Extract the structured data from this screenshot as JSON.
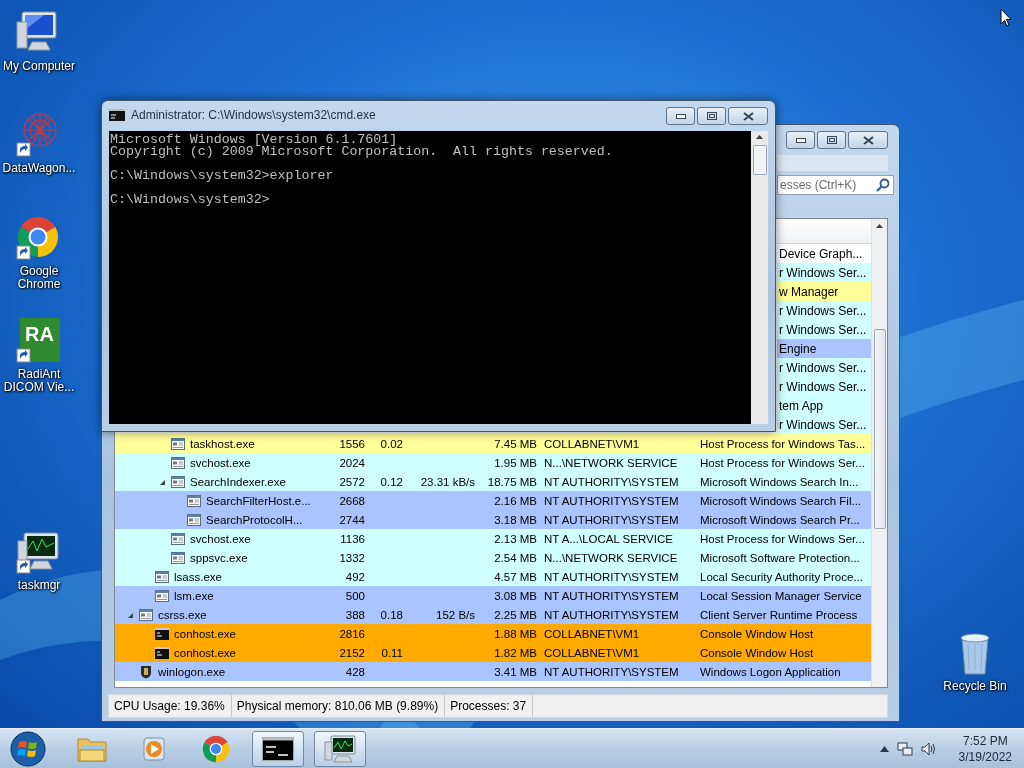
{
  "desktop_icons": [
    {
      "label": "My Computer",
      "kind": "computer",
      "shortcut": false
    },
    {
      "label": "DataWagon...",
      "kind": "network",
      "shortcut": true
    },
    {
      "label": "Google Chrome",
      "kind": "chrome",
      "shortcut": true
    },
    {
      "label": "RadiAnt DICOM Vie...",
      "kind": "logo",
      "logo_text": "RA",
      "shortcut": true
    },
    {
      "label": "taskmgr",
      "kind": "monitor",
      "shortcut": true
    },
    {
      "label": "Recycle Bin",
      "kind": "bin",
      "shortcut": false
    }
  ],
  "process_window": {
    "search": {
      "placeholder": "esses (Ctrl+K)"
    },
    "processes": [
      {
        "children": [
          {
            "children": [
              {
                "description": "Device Graph...",
                "color": "#ffffff"
              },
              {
                "description": "r Windows Ser...",
                "color": "#d0ffff"
              },
              {
                "description": "w Manager",
                "color": "#ffff99"
              },
              {
                "description": "r Windows Ser...",
                "color": "#d0ffff"
              },
              {
                "description": "r Windows Ser...",
                "color": "#d0ffff"
              },
              {
                "description": "Engine",
                "color": "#aac4ff"
              },
              {
                "description": "r Windows Ser...",
                "color": "#d0ffff"
              },
              {
                "description": "r Windows Ser...",
                "color": "#d0ffff"
              },
              {
                "description": "tem App",
                "color": "#d0ffff"
              },
              {
                "description": "r Windows Ser...",
                "color": "#d0ffff"
              },
              {
                "kind": "process",
                "name": "taskhost.exe",
                "pid": "1556",
                "cpu": "0.02",
                "private": "7.45 MB",
                "user": "COLLABNET\\VM1",
                "description": "Host Process for Windows Tas...",
                "color": "#ffff99"
              },
              {
                "kind": "process",
                "name": "svchost.exe",
                "pid": "2024",
                "private": "1.95 MB",
                "user": "N...\\NETWORK SERVICE",
                "description": "Host Process for Windows Ser...",
                "color": "#d0ffff"
              },
              {
                "kind": "process",
                "name": "SearchIndexer.exe",
                "pid": "2572",
                "cpu": "0.12",
                "io": "23.31 kB/s",
                "private": "18.75 MB",
                "user": "NT AUTHORITY\\SYSTEM",
                "description": "Microsoft Windows Search In...",
                "color": "#d0ffff",
                "expanded": true,
                "children": [
                  {
                    "kind": "process",
                    "name": "SearchFilterHost.e...",
                    "pid": "2668",
                    "private": "2.16 MB",
                    "user": "NT AUTHORITY\\SYSTEM",
                    "description": "Microsoft Windows Search Fil...",
                    "color": "#aac4ff"
                  },
                  {
                    "kind": "process",
                    "name": "SearchProtocolH...",
                    "pid": "2744",
                    "private": "3.18 MB",
                    "user": "NT AUTHORITY\\SYSTEM",
                    "description": "Microsoft Windows Search Pr...",
                    "color": "#aac4ff"
                  }
                ]
              },
              {
                "kind": "process",
                "name": "svchost.exe",
                "pid": "1136",
                "private": "2.13 MB",
                "user": "NT A...\\LOCAL SERVICE",
                "description": "Host Process for Windows Ser...",
                "color": "#d0ffff"
              },
              {
                "kind": "process",
                "name": "sppsvc.exe",
                "pid": "1332",
                "private": "2.54 MB",
                "user": "N...\\NETWORK SERVICE",
                "description": "Microsoft Software Protection...",
                "color": "#d0ffff"
              }
            ]
          },
          {
            "kind": "process",
            "name": "lsass.exe",
            "pid": "492",
            "private": "4.57 MB",
            "user": "NT AUTHORITY\\SYSTEM",
            "description": "Local Security Authority Proce...",
            "color": "#d0ffff"
          },
          {
            "kind": "process",
            "name": "lsm.exe",
            "pid": "500",
            "private": "3.08 MB",
            "user": "NT AUTHORITY\\SYSTEM",
            "description": "Local Session Manager Service",
            "color": "#aac4ff"
          }
        ]
      },
      {
        "kind": "process",
        "name": "csrss.exe",
        "pid": "388",
        "cpu": "0.18",
        "io": "152 B/s",
        "private": "2.25 MB",
        "user": "NT AUTHORITY\\SYSTEM",
        "description": "Client Server Runtime Process",
        "color": "#aac4ff",
        "expanded": true,
        "children": [
          {
            "kind": "console",
            "name": "conhost.exe",
            "pid": "2816",
            "private": "1.88 MB",
            "user": "COLLABNET\\VM1",
            "description": "Console Window Host",
            "color": "#ffaa00"
          },
          {
            "kind": "console",
            "name": "conhost.exe",
            "pid": "2152",
            "cpu": "0.11",
            "private": "1.82 MB",
            "user": "COLLABNET\\VM1",
            "description": "Console Window Host",
            "color": "#ffaa00"
          }
        ]
      },
      {
        "kind": "logon",
        "name": "winlogon.exe",
        "pid": "428",
        "private": "3.41 MB",
        "user": "NT AUTHORITY\\SYSTEM",
        "description": "Windows Logon Application",
        "color": "#aac4ff"
      }
    ],
    "status_bar": [
      "CPU Usage: 19.36%",
      "Physical memory: 810.06 MB (9.89%)",
      "Processes: 37"
    ]
  },
  "console_window": {
    "title": "Administrator: C:\\Windows\\system32\\cmd.exe",
    "output": "Microsoft Windows [Version 6.1.7601]\nCopyright (c) 2009 Microsoft Corporation.  All rights reserved.\n\nC:\\Windows\\system32>explorer\n\nC:\\Windows\\system32>"
  },
  "taskbar": {
    "items": [
      {
        "kind": "folder",
        "open": false
      },
      {
        "kind": "media",
        "open": false
      },
      {
        "kind": "chrome",
        "open": false
      },
      {
        "kind": "console",
        "open": true
      },
      {
        "kind": "monitor",
        "open": true
      }
    ],
    "clock": {
      "time": "7:52 PM",
      "date": "3/19/2022"
    }
  }
}
